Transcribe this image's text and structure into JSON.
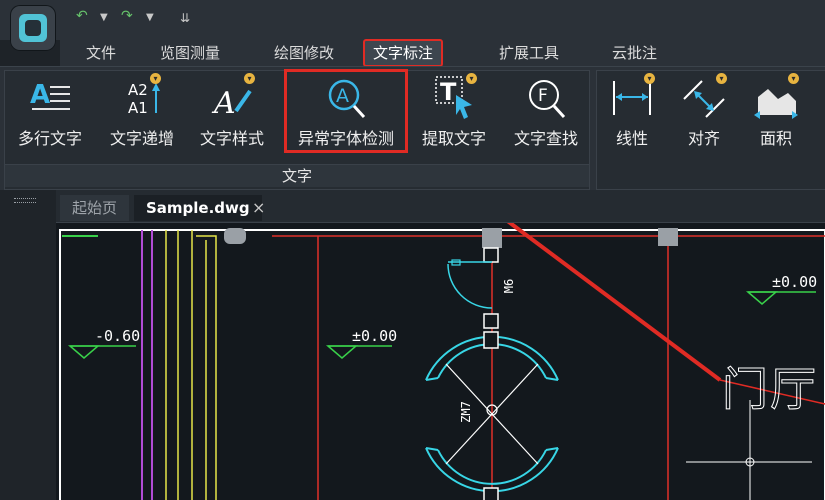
{
  "menu_tabs": [
    {
      "label": "文件"
    },
    {
      "label": "览图测量"
    },
    {
      "label": "绘图修改"
    },
    {
      "label": "文字标注",
      "active": true
    },
    {
      "label": "扩展工具"
    },
    {
      "label": "云批注"
    }
  ],
  "ribbon": {
    "text_group_label": "文字",
    "text_group": [
      {
        "label": "多行文字",
        "icon": "multiline-text-icon"
      },
      {
        "label": "文字递增",
        "icon": "text-increment-icon"
      },
      {
        "label": "文字样式",
        "icon": "text-style-icon"
      },
      {
        "label": "异常字体检测",
        "icon": "font-detect-icon",
        "highlighted": true
      },
      {
        "label": "提取文字",
        "icon": "extract-text-icon"
      },
      {
        "label": "文字查找",
        "icon": "text-find-icon"
      }
    ],
    "dim_group": [
      {
        "label": "线性",
        "icon": "linear-dimension-icon"
      },
      {
        "label": "对齐",
        "icon": "aligned-dimension-icon"
      },
      {
        "label": "面积",
        "icon": "area-icon"
      }
    ]
  },
  "doc_tabs": {
    "start_label": "起始页",
    "current_label": "Sample.dwg",
    "close_glyph": "×"
  },
  "drawing": {
    "level_left": "-0.60",
    "level_mid": "±0.00",
    "level_right": "±0.00",
    "label_m6": "M6",
    "label_zm7": "ZM7",
    "room_text": "门厅"
  },
  "colors": {
    "accent_red": "#e02b24",
    "cad_cyan": "#38d6e6",
    "cad_red": "#e0302a",
    "cad_yellow": "#e6e64a",
    "cad_purple": "#b14cd6"
  }
}
